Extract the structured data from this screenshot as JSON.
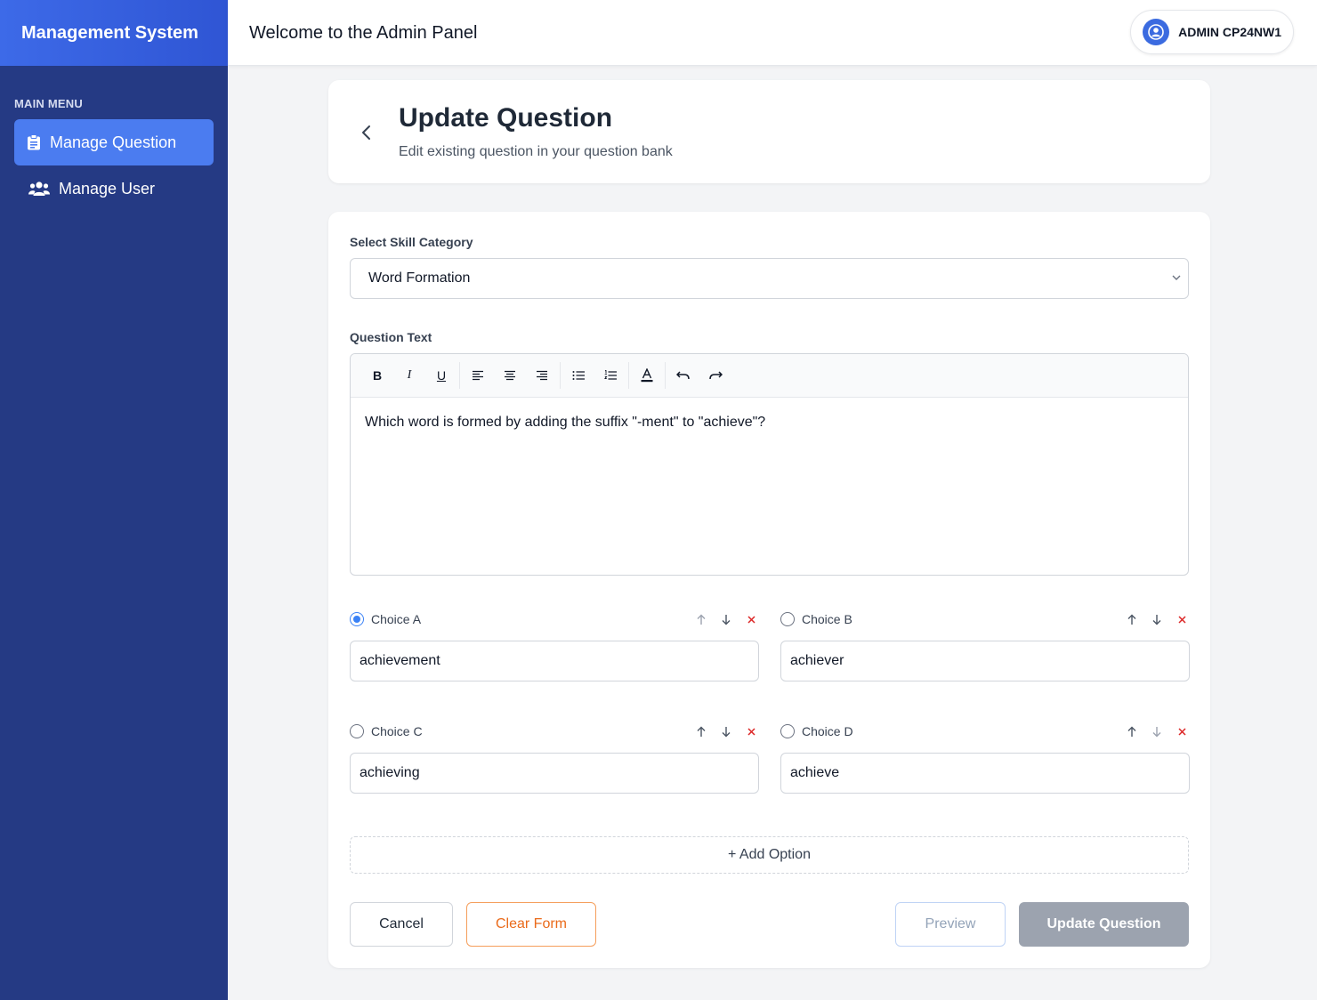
{
  "app": {
    "brand": "Management System",
    "header_title": "Welcome to the Admin Panel",
    "user_name": "ADMIN CP24NW1"
  },
  "sidebar": {
    "section_title": "MAIN MENU",
    "items": [
      {
        "label": "Manage Question",
        "icon": "clipboard-icon",
        "active": true
      },
      {
        "label": "Manage User",
        "icon": "users-icon",
        "active": false
      }
    ]
  },
  "page": {
    "title": "Update Question",
    "subtitle": "Edit existing question in your question bank"
  },
  "form": {
    "category_label": "Select Skill Category",
    "category_value": "Word Formation",
    "question_label": "Question Text",
    "question_text": "Which word is formed by adding the suffix \"-ment\" to \"achieve\"?",
    "toolbar": [
      "bold",
      "italic",
      "underline",
      "align-left",
      "align-center",
      "align-right",
      "bullet-list",
      "numbered-list",
      "text-color",
      "undo",
      "redo"
    ],
    "toolbar_text": {
      "bold": "B",
      "italic": "I",
      "underline": "U"
    },
    "choices": [
      {
        "label": "Choice A",
        "value": "achievement",
        "selected": true
      },
      {
        "label": "Choice B",
        "value": "achiever",
        "selected": false
      },
      {
        "label": "Choice C",
        "value": "achieving",
        "selected": false
      },
      {
        "label": "Choice D",
        "value": "achieve",
        "selected": false
      }
    ],
    "add_option": "+ Add Option",
    "buttons": {
      "cancel": "Cancel",
      "clear": "Clear Form",
      "preview": "Preview",
      "update": "Update Question"
    }
  },
  "colors": {
    "sidebar_bg": "#253a84",
    "brand_accent": "#3d6ae8",
    "active_item": "#4b7cf0",
    "clear_orange": "#ea6a1a",
    "delete_red": "#dc2626",
    "update_disabled": "#9ca3af"
  }
}
